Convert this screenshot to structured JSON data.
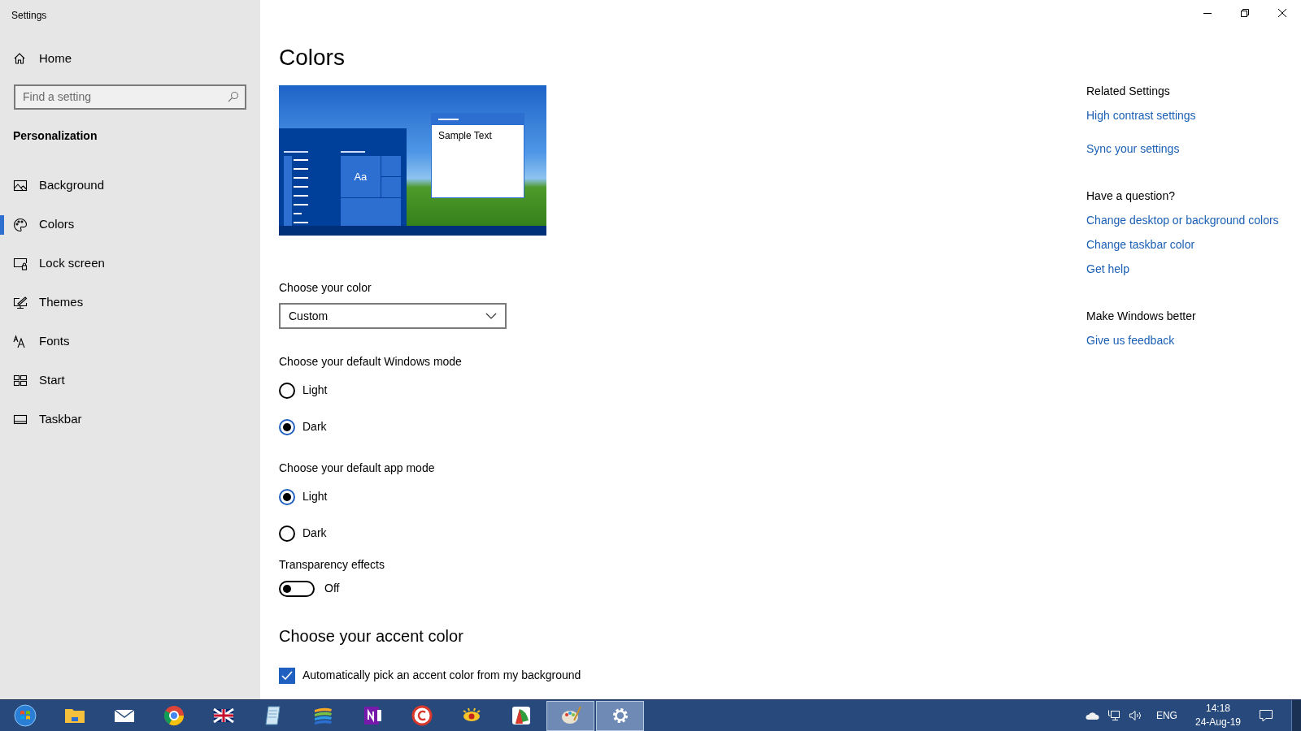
{
  "window": {
    "title": "Settings"
  },
  "sidebar": {
    "home": "Home",
    "search": {
      "placeholder": "Find a setting"
    },
    "section": "Personalization",
    "items": [
      {
        "label": "Background",
        "selected": false
      },
      {
        "label": "Colors",
        "selected": true
      },
      {
        "label": "Lock screen",
        "selected": false
      },
      {
        "label": "Themes",
        "selected": false
      },
      {
        "label": "Fonts",
        "selected": false
      },
      {
        "label": "Start",
        "selected": false
      },
      {
        "label": "Taskbar",
        "selected": false
      }
    ]
  },
  "main": {
    "title": "Colors",
    "preview": {
      "tile": "Aa",
      "sample_text": "Sample Text"
    },
    "choose_color": {
      "label": "Choose your color",
      "value": "Custom"
    },
    "radio_groups": [
      {
        "label": "Choose your default Windows mode",
        "options": [
          {
            "label": "Light",
            "selected": false
          },
          {
            "label": "Dark",
            "selected": true
          }
        ]
      },
      {
        "label": "Choose your default app mode",
        "options": [
          {
            "label": "Light",
            "selected": true
          },
          {
            "label": "Dark",
            "selected": false
          }
        ]
      }
    ],
    "transparency": {
      "label": "Transparency effects",
      "on": false,
      "state": "Off"
    },
    "accent": {
      "heading": "Choose your accent color",
      "checkbox": {
        "label": "Automatically pick an accent color from my background",
        "checked": true
      }
    }
  },
  "related": [
    {
      "heading": "Related Settings",
      "links": [
        "High contrast settings",
        "Sync your settings"
      ]
    },
    {
      "heading": "Have a question?",
      "links": [
        "Change desktop or background colors",
        "Change taskbar color",
        "Get help"
      ]
    },
    {
      "heading": "Make Windows better",
      "links": [
        "Give us feedback"
      ]
    }
  ],
  "taskbar": {
    "apps": [
      {
        "active": false
      },
      {
        "active": false
      },
      {
        "active": false
      },
      {
        "active": false
      },
      {
        "active": false
      },
      {
        "active": false
      },
      {
        "active": false
      },
      {
        "active": false
      },
      {
        "active": false
      },
      {
        "active": false
      },
      {
        "active": false
      },
      {
        "active": true
      },
      {
        "active": true
      }
    ],
    "language": "ENG",
    "time": "14:18",
    "date": "24-Aug-19"
  }
}
